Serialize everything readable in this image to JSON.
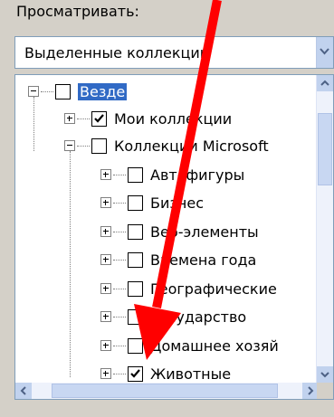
{
  "browse_label": "Просматривать:",
  "combo": {
    "value": "Выделенные коллекции"
  },
  "tree": {
    "items": [
      {
        "label": "Везде",
        "checked": false,
        "selected": true
      },
      {
        "label": "Мои коллекции",
        "checked": true
      },
      {
        "label": "Коллекции Microsoft",
        "checked": false
      },
      {
        "label": "Автофигуры",
        "checked": false
      },
      {
        "label": "Бизнес",
        "checked": false
      },
      {
        "label": "Веб-элементы",
        "checked": false
      },
      {
        "label": "Времена года",
        "checked": false
      },
      {
        "label": "Географические",
        "checked": false
      },
      {
        "label": "Государство",
        "checked": false
      },
      {
        "label": "Домашнее хозяй",
        "checked": false
      },
      {
        "label": "Животные",
        "checked": true
      }
    ]
  },
  "colors": {
    "selection": "#316ac5",
    "annotation_arrow": "#ff0000"
  }
}
